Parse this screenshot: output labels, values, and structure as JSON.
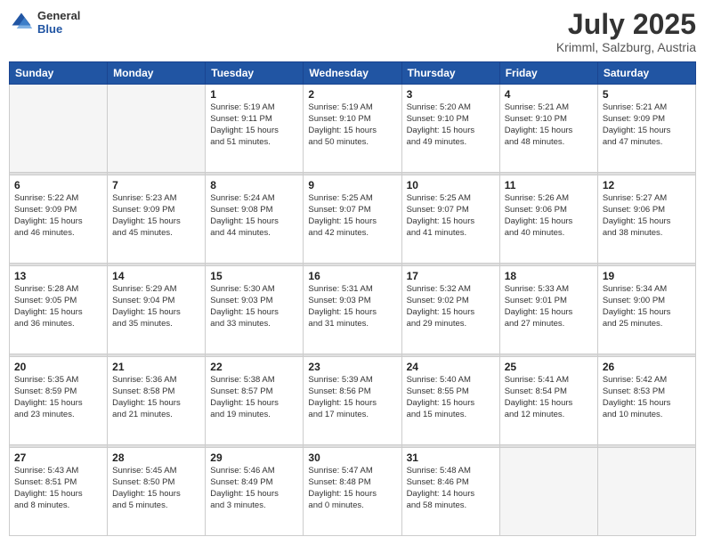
{
  "header": {
    "logo_general": "General",
    "logo_blue": "Blue",
    "month": "July 2025",
    "location": "Krimml, Salzburg, Austria"
  },
  "days_of_week": [
    "Sunday",
    "Monday",
    "Tuesday",
    "Wednesday",
    "Thursday",
    "Friday",
    "Saturday"
  ],
  "weeks": [
    [
      {
        "day": "",
        "info": ""
      },
      {
        "day": "",
        "info": ""
      },
      {
        "day": "1",
        "info": "Sunrise: 5:19 AM\nSunset: 9:11 PM\nDaylight: 15 hours\nand 51 minutes."
      },
      {
        "day": "2",
        "info": "Sunrise: 5:19 AM\nSunset: 9:10 PM\nDaylight: 15 hours\nand 50 minutes."
      },
      {
        "day": "3",
        "info": "Sunrise: 5:20 AM\nSunset: 9:10 PM\nDaylight: 15 hours\nand 49 minutes."
      },
      {
        "day": "4",
        "info": "Sunrise: 5:21 AM\nSunset: 9:10 PM\nDaylight: 15 hours\nand 48 minutes."
      },
      {
        "day": "5",
        "info": "Sunrise: 5:21 AM\nSunset: 9:09 PM\nDaylight: 15 hours\nand 47 minutes."
      }
    ],
    [
      {
        "day": "6",
        "info": "Sunrise: 5:22 AM\nSunset: 9:09 PM\nDaylight: 15 hours\nand 46 minutes."
      },
      {
        "day": "7",
        "info": "Sunrise: 5:23 AM\nSunset: 9:09 PM\nDaylight: 15 hours\nand 45 minutes."
      },
      {
        "day": "8",
        "info": "Sunrise: 5:24 AM\nSunset: 9:08 PM\nDaylight: 15 hours\nand 44 minutes."
      },
      {
        "day": "9",
        "info": "Sunrise: 5:25 AM\nSunset: 9:07 PM\nDaylight: 15 hours\nand 42 minutes."
      },
      {
        "day": "10",
        "info": "Sunrise: 5:25 AM\nSunset: 9:07 PM\nDaylight: 15 hours\nand 41 minutes."
      },
      {
        "day": "11",
        "info": "Sunrise: 5:26 AM\nSunset: 9:06 PM\nDaylight: 15 hours\nand 40 minutes."
      },
      {
        "day": "12",
        "info": "Sunrise: 5:27 AM\nSunset: 9:06 PM\nDaylight: 15 hours\nand 38 minutes."
      }
    ],
    [
      {
        "day": "13",
        "info": "Sunrise: 5:28 AM\nSunset: 9:05 PM\nDaylight: 15 hours\nand 36 minutes."
      },
      {
        "day": "14",
        "info": "Sunrise: 5:29 AM\nSunset: 9:04 PM\nDaylight: 15 hours\nand 35 minutes."
      },
      {
        "day": "15",
        "info": "Sunrise: 5:30 AM\nSunset: 9:03 PM\nDaylight: 15 hours\nand 33 minutes."
      },
      {
        "day": "16",
        "info": "Sunrise: 5:31 AM\nSunset: 9:03 PM\nDaylight: 15 hours\nand 31 minutes."
      },
      {
        "day": "17",
        "info": "Sunrise: 5:32 AM\nSunset: 9:02 PM\nDaylight: 15 hours\nand 29 minutes."
      },
      {
        "day": "18",
        "info": "Sunrise: 5:33 AM\nSunset: 9:01 PM\nDaylight: 15 hours\nand 27 minutes."
      },
      {
        "day": "19",
        "info": "Sunrise: 5:34 AM\nSunset: 9:00 PM\nDaylight: 15 hours\nand 25 minutes."
      }
    ],
    [
      {
        "day": "20",
        "info": "Sunrise: 5:35 AM\nSunset: 8:59 PM\nDaylight: 15 hours\nand 23 minutes."
      },
      {
        "day": "21",
        "info": "Sunrise: 5:36 AM\nSunset: 8:58 PM\nDaylight: 15 hours\nand 21 minutes."
      },
      {
        "day": "22",
        "info": "Sunrise: 5:38 AM\nSunset: 8:57 PM\nDaylight: 15 hours\nand 19 minutes."
      },
      {
        "day": "23",
        "info": "Sunrise: 5:39 AM\nSunset: 8:56 PM\nDaylight: 15 hours\nand 17 minutes."
      },
      {
        "day": "24",
        "info": "Sunrise: 5:40 AM\nSunset: 8:55 PM\nDaylight: 15 hours\nand 15 minutes."
      },
      {
        "day": "25",
        "info": "Sunrise: 5:41 AM\nSunset: 8:54 PM\nDaylight: 15 hours\nand 12 minutes."
      },
      {
        "day": "26",
        "info": "Sunrise: 5:42 AM\nSunset: 8:53 PM\nDaylight: 15 hours\nand 10 minutes."
      }
    ],
    [
      {
        "day": "27",
        "info": "Sunrise: 5:43 AM\nSunset: 8:51 PM\nDaylight: 15 hours\nand 8 minutes."
      },
      {
        "day": "28",
        "info": "Sunrise: 5:45 AM\nSunset: 8:50 PM\nDaylight: 15 hours\nand 5 minutes."
      },
      {
        "day": "29",
        "info": "Sunrise: 5:46 AM\nSunset: 8:49 PM\nDaylight: 15 hours\nand 3 minutes."
      },
      {
        "day": "30",
        "info": "Sunrise: 5:47 AM\nSunset: 8:48 PM\nDaylight: 15 hours\nand 0 minutes."
      },
      {
        "day": "31",
        "info": "Sunrise: 5:48 AM\nSunset: 8:46 PM\nDaylight: 14 hours\nand 58 minutes."
      },
      {
        "day": "",
        "info": ""
      },
      {
        "day": "",
        "info": ""
      }
    ]
  ]
}
